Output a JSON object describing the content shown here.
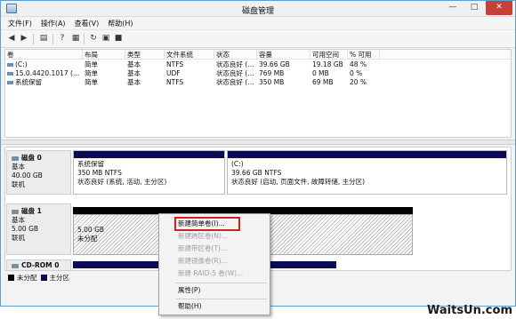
{
  "window": {
    "title": "磁盘管理"
  },
  "menubar": [
    "文件(F)",
    "操作(A)",
    "查看(V)",
    "帮助(H)"
  ],
  "volumes": {
    "columns": [
      "卷",
      "布局",
      "类型",
      "文件系统",
      "状态",
      "容量",
      "可用空间",
      "% 可用"
    ],
    "rows": [
      [
        "(C:)",
        "简单",
        "基本",
        "NTFS",
        "状态良好 (...",
        "39.66 GB",
        "19.18 GB",
        "48 %"
      ],
      [
        "15.0.4420.1017 (...",
        "简单",
        "基本",
        "UDF",
        "状态良好 (...",
        "769 MB",
        "0 MB",
        "0 %"
      ],
      [
        "系统保留",
        "简单",
        "基本",
        "NTFS",
        "状态良好 (...",
        "350 MB",
        "69 MB",
        "20 %"
      ]
    ]
  },
  "disks": {
    "disk0": {
      "name": "磁盘 0",
      "type": "基本",
      "size": "40.00 GB",
      "status": "联机",
      "p1": {
        "name": "系统保留",
        "size": "350 MB NTFS",
        "status": "状态良好 (系统, 活动, 主分区)"
      },
      "p2": {
        "name": "(C:)",
        "size": "39.66 GB NTFS",
        "status": "状态良好 (启动, 页面文件, 故障转储, 主分区)"
      }
    },
    "disk1": {
      "name": "磁盘 1",
      "type": "基本",
      "size": "5.00 GB",
      "status": "联机",
      "p1": {
        "size": "5.00 GB",
        "status": "未分配"
      }
    },
    "cdrom": {
      "name": "CD-ROM 0"
    }
  },
  "legend": {
    "unallocated": "未分配",
    "primary": "主分区",
    "unallocated_color": "#000000",
    "primary_color": "#0a0a55"
  },
  "context_menu": {
    "items": [
      {
        "label": "新建简单卷(I)...",
        "enabled": true
      },
      {
        "label": "新建跨区卷(N)...",
        "enabled": false
      },
      {
        "label": "新建带区卷(T)...",
        "enabled": false
      },
      {
        "label": "新建镜像卷(R)...",
        "enabled": false
      },
      {
        "label": "新建 RAID-5 卷(W)...",
        "enabled": false
      },
      {
        "label": "属性(P)",
        "enabled": true
      },
      {
        "label": "帮助(H)",
        "enabled": true
      }
    ]
  },
  "watermark": "WaitsUn.com"
}
